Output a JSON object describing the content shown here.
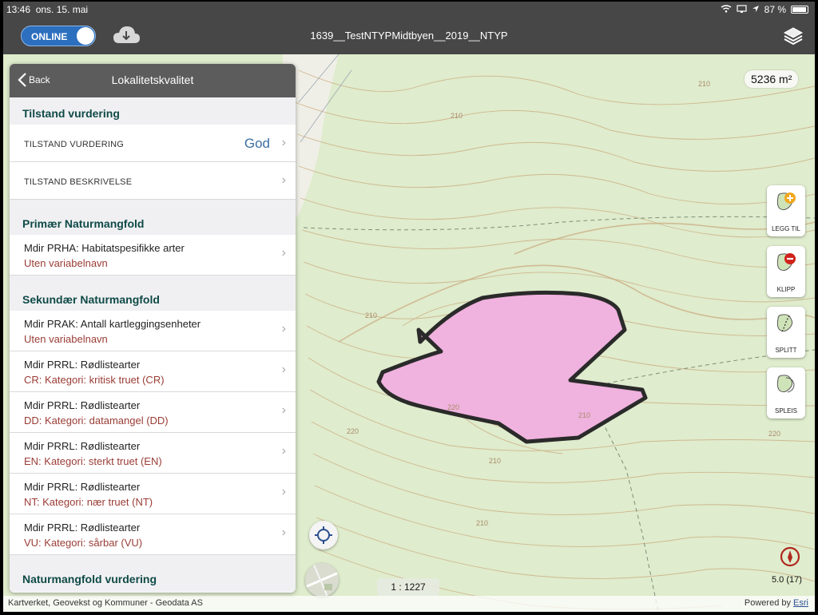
{
  "status_bar": {
    "time": "13:46",
    "date": "ons. 15. mai",
    "battery": "87 %"
  },
  "top_bar": {
    "online_label": "ONLINE",
    "title": "1639__TestNTYPMidtbyen__2019__NTYP"
  },
  "panel": {
    "back_label": "Back",
    "title": "Lokalitetskvalitet",
    "sections": {
      "tilstand": "Tilstand vurdering",
      "primaer": "Primær Naturmangfold",
      "sekundaer": "Sekundær Naturmangfold",
      "vurdering": "Naturmangfold vurdering"
    },
    "tilstand_vurdering": {
      "label": "TILSTAND VURDERING",
      "value": "God"
    },
    "tilstand_beskrivelse": {
      "label": "TILSTAND BESKRIVELSE"
    },
    "primary_rows": [
      {
        "title": "Mdir PRHA: Habitatspesifikke arter",
        "subtitle": "Uten variabelnavn"
      }
    ],
    "secondary_rows": [
      {
        "title": "Mdir PRAK: Antall kartleggingsenheter",
        "subtitle": "Uten variabelnavn"
      },
      {
        "title": "Mdir PRRL: Rødlistearter",
        "subtitle": "CR: Kategori: kritisk truet (CR)"
      },
      {
        "title": "Mdir PRRL: Rødlistearter",
        "subtitle": "DD: Kategori: datamangel (DD)"
      },
      {
        "title": "Mdir PRRL: Rødlistearter",
        "subtitle": "EN: Kategori: sterkt truet (EN)"
      },
      {
        "title": "Mdir PRRL: Rødlistearter",
        "subtitle": "NT: Kategori: nær truet (NT)"
      },
      {
        "title": "Mdir PRRL: Rødlistearter",
        "subtitle": "VU: Kategori: sårbar (VU)"
      }
    ]
  },
  "map": {
    "area": "5236 m²",
    "scale": "1 : 1227",
    "zoom": "5.0 (17)",
    "contour_labels": [
      "210",
      "220",
      "210",
      "220",
      "210",
      "210",
      "220",
      "210",
      "210"
    ],
    "polygon_color": "#f0b2de",
    "tools": {
      "add": "LEGG TIL",
      "clip": "KLIPP",
      "split": "SPLITT",
      "merge": "SPLEIS"
    }
  },
  "attribution": {
    "left": "Kartverket, Geovekst og Kommuner - Geodata AS",
    "powered": "Powered by",
    "brand": "Esri"
  }
}
